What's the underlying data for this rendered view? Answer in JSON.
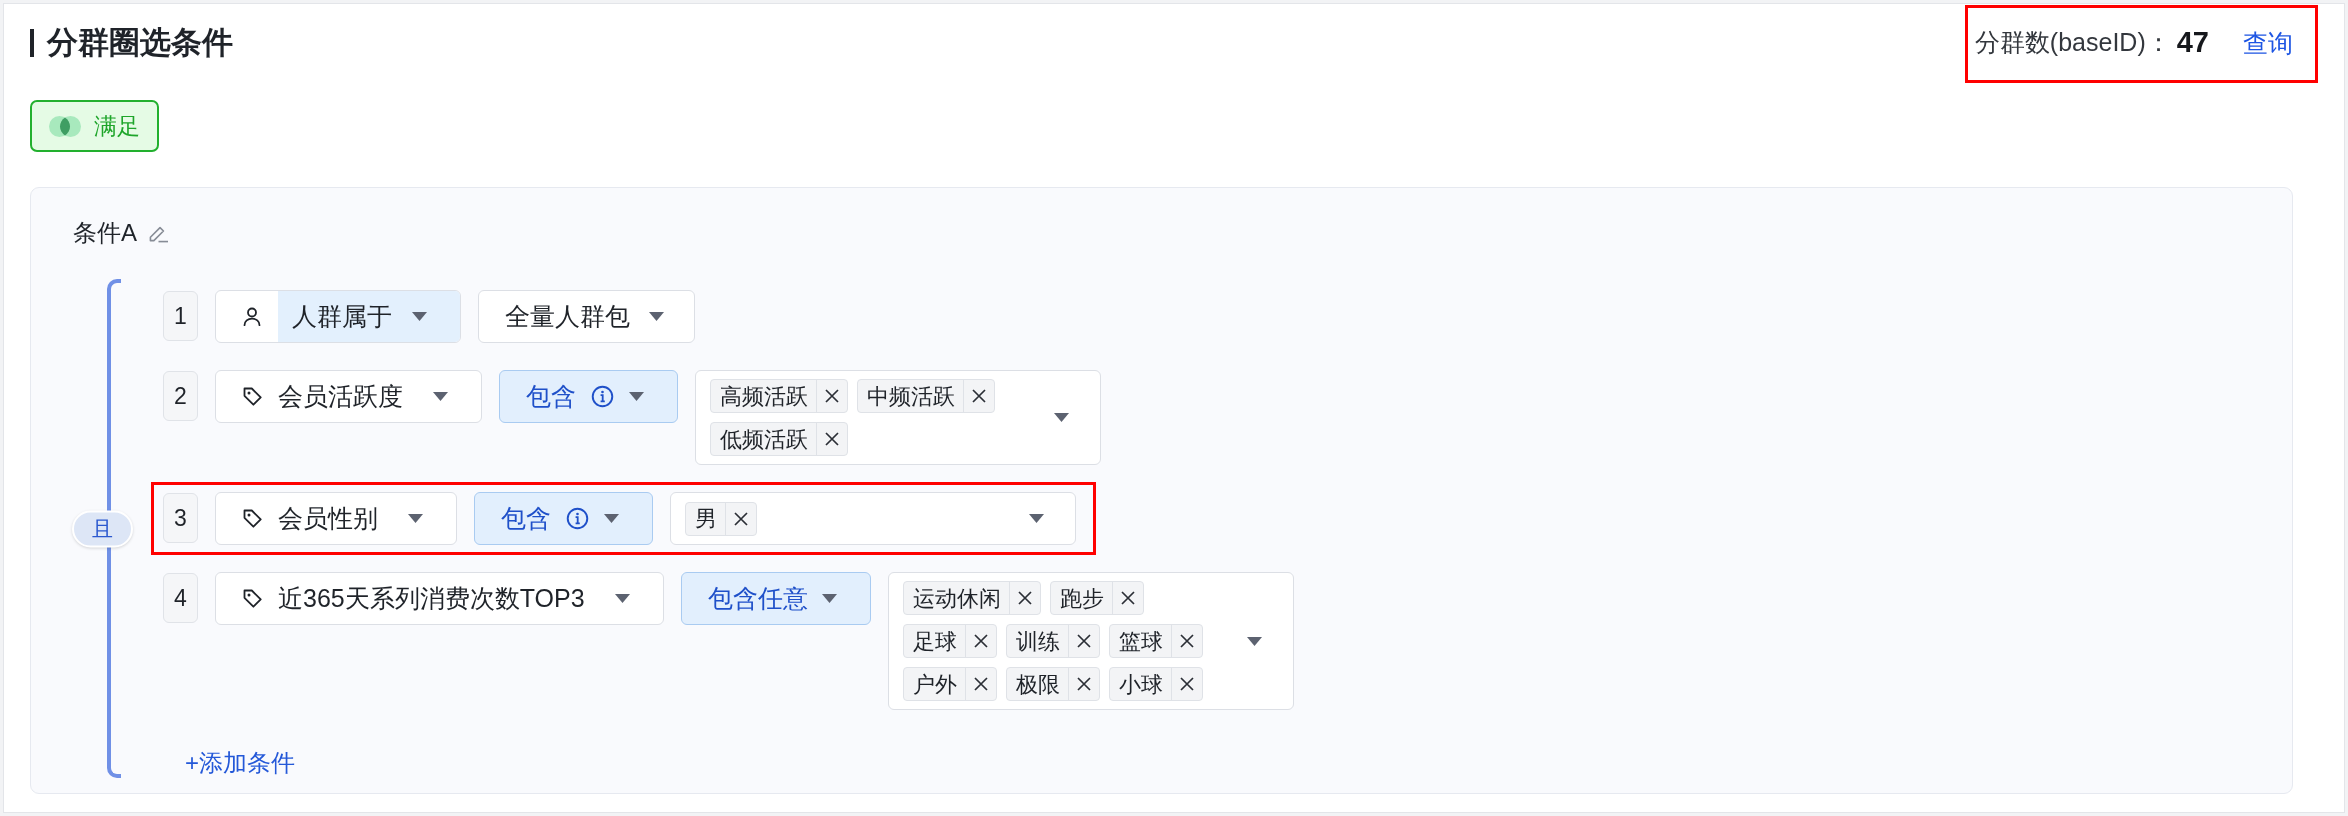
{
  "title": "分群圈选条件",
  "stats": {
    "label": "分群数(baseID)：",
    "value": "47",
    "action": "查询",
    "highlighted": true
  },
  "match_mode": {
    "label": "满足"
  },
  "condition_group": {
    "name": "条件A",
    "connector": "且",
    "conditions": [
      {
        "number": "1",
        "kind": "audience",
        "highlighted": false,
        "field": {
          "label": "人群属于",
          "active": true
        },
        "value": "全量人群包"
      },
      {
        "number": "2",
        "kind": "tag",
        "highlighted": false,
        "field": {
          "label": "会员活跃度",
          "active": false
        },
        "operator": {
          "label": "包含",
          "info": true
        },
        "tags": [
          "高频活跃",
          "中频活跃",
          "低频活跃"
        ]
      },
      {
        "number": "3",
        "kind": "tag",
        "highlighted": true,
        "field": {
          "label": "会员性别",
          "active": false
        },
        "operator": {
          "label": "包含",
          "info": true
        },
        "tags": [
          "男"
        ]
      },
      {
        "number": "4",
        "kind": "tag",
        "highlighted": false,
        "field": {
          "label": "近365天系列消费次数TOP3",
          "active": false
        },
        "operator": {
          "label": "包含任意",
          "info": false
        },
        "tags": [
          "运动休闲",
          "跑步",
          "足球",
          "训练",
          "篮球",
          "户外",
          "极限",
          "小球"
        ]
      }
    ],
    "add_label": "+添加条件"
  }
}
